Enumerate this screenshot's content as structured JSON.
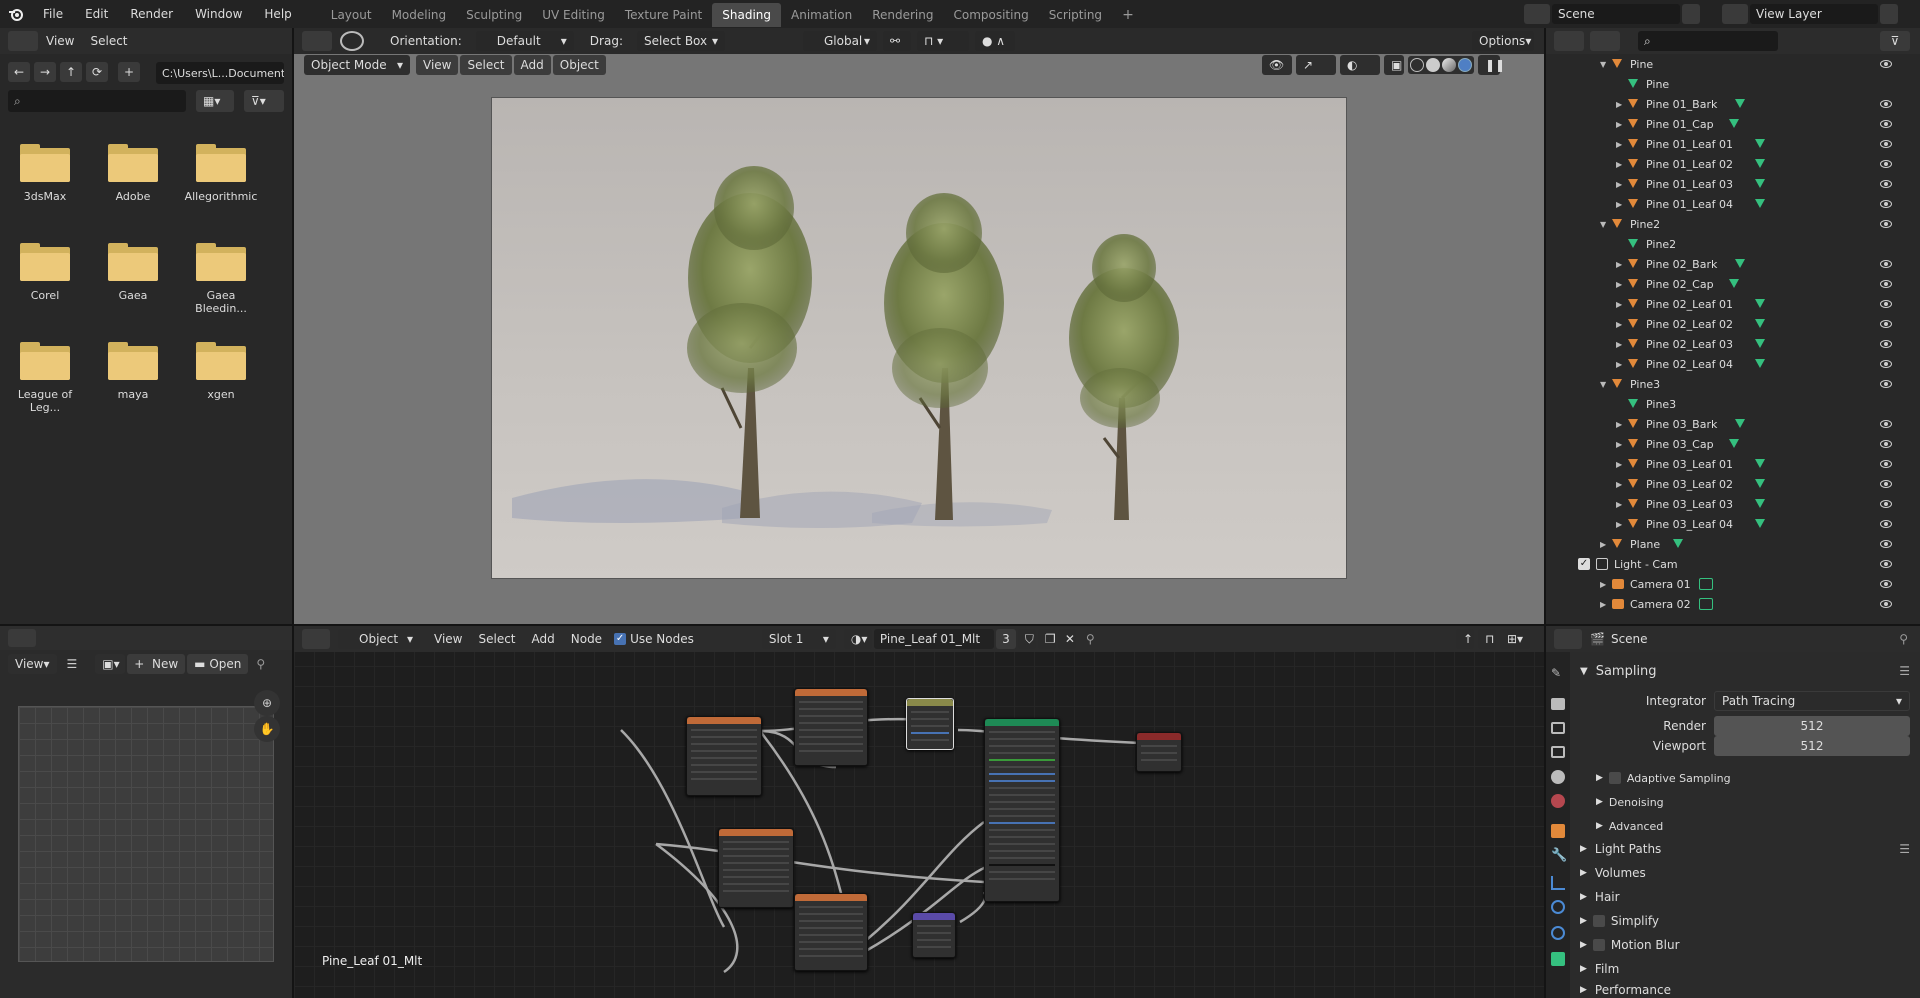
{
  "topbar": {
    "menus": [
      "File",
      "Edit",
      "Render",
      "Window",
      "Help"
    ],
    "workspaces": [
      "Layout",
      "Modeling",
      "Sculpting",
      "UV Editing",
      "Texture Paint",
      "Shading",
      "Animation",
      "Rendering",
      "Compositing",
      "Scripting"
    ],
    "active_workspace": "Shading",
    "add_tab": "+",
    "scene": "Scene",
    "view_layer": "View Layer"
  },
  "file_browser": {
    "menus": [
      "View",
      "Select"
    ],
    "path": "C:\\Users\\L...Documents\\",
    "search_placeholder": "",
    "folders": [
      "3dsMax",
      "Adobe",
      "Allegorithmic",
      "Corel",
      "Gaea",
      "Gaea Bleedin...",
      "League of Leg...",
      "maya",
      "xgen"
    ]
  },
  "viewport": {
    "orientation_label": "Orientation:",
    "orientation_value": "Default",
    "drag_label": "Drag:",
    "drag_value": "Select Box",
    "transform": "Global",
    "options": "Options",
    "mode": "Object Mode",
    "menus": [
      "View",
      "Select",
      "Add",
      "Object"
    ]
  },
  "outliner": {
    "rows": [
      {
        "label": "Pine",
        "type": "empty",
        "indent": 1,
        "expanded": true,
        "eye": true
      },
      {
        "label": "Pine",
        "type": "mesh",
        "indent": 2,
        "eye": false
      },
      {
        "label": "Pine 01_Bark",
        "type": "obj",
        "indent": 2,
        "eye": true
      },
      {
        "label": "Pine 01_Cap",
        "type": "obj",
        "indent": 2,
        "eye": true
      },
      {
        "label": "Pine 01_Leaf 01",
        "type": "obj",
        "indent": 2,
        "eye": true
      },
      {
        "label": "Pine 01_Leaf 02",
        "type": "obj",
        "indent": 2,
        "eye": true
      },
      {
        "label": "Pine 01_Leaf 03",
        "type": "obj",
        "indent": 2,
        "eye": true
      },
      {
        "label": "Pine 01_Leaf 04",
        "type": "obj",
        "indent": 2,
        "eye": true
      },
      {
        "label": "Pine2",
        "type": "empty",
        "indent": 1,
        "expanded": true,
        "eye": true
      },
      {
        "label": "Pine2",
        "type": "mesh",
        "indent": 2,
        "eye": false
      },
      {
        "label": "Pine 02_Bark",
        "type": "obj",
        "indent": 2,
        "eye": true
      },
      {
        "label": "Pine 02_Cap",
        "type": "obj",
        "indent": 2,
        "eye": true
      },
      {
        "label": "Pine 02_Leaf 01",
        "type": "obj",
        "indent": 2,
        "eye": true
      },
      {
        "label": "Pine 02_Leaf 02",
        "type": "obj",
        "indent": 2,
        "eye": true
      },
      {
        "label": "Pine 02_Leaf 03",
        "type": "obj",
        "indent": 2,
        "eye": true
      },
      {
        "label": "Pine 02_Leaf 04",
        "type": "obj",
        "indent": 2,
        "eye": true
      },
      {
        "label": "Pine3",
        "type": "empty",
        "indent": 1,
        "expanded": true,
        "eye": true
      },
      {
        "label": "Pine3",
        "type": "mesh",
        "indent": 2,
        "eye": false
      },
      {
        "label": "Pine 03_Bark",
        "type": "obj",
        "indent": 2,
        "eye": true
      },
      {
        "label": "Pine 03_Cap",
        "type": "obj",
        "indent": 2,
        "eye": true
      },
      {
        "label": "Pine 03_Leaf 01",
        "type": "obj",
        "indent": 2,
        "eye": true
      },
      {
        "label": "Pine 03_Leaf 02",
        "type": "obj",
        "indent": 2,
        "eye": true
      },
      {
        "label": "Pine 03_Leaf 03",
        "type": "obj",
        "indent": 2,
        "eye": true
      },
      {
        "label": "Pine 03_Leaf 04",
        "type": "obj",
        "indent": 2,
        "eye": true
      },
      {
        "label": "Plane",
        "type": "obj",
        "indent": 1,
        "eye": true
      },
      {
        "label": "Light - Cam",
        "type": "collection",
        "indent": 0,
        "eye": true
      },
      {
        "label": "Camera 01",
        "type": "camera",
        "indent": 1,
        "eye": true
      },
      {
        "label": "Camera 02",
        "type": "camera",
        "indent": 1,
        "eye": true
      }
    ]
  },
  "image_editor": {
    "view": "View",
    "new_button": "New",
    "open_button": "Open"
  },
  "node_editor": {
    "object_type": "Object",
    "menus": [
      "View",
      "Select",
      "Add",
      "Node"
    ],
    "use_nodes": "Use Nodes",
    "slot": "Slot 1",
    "material": "Pine_Leaf 01_Mlt",
    "users": "3",
    "material_label": "Pine_Leaf 01_Mlt"
  },
  "properties": {
    "scene": "Scene",
    "sampling": "Sampling",
    "integrator_label": "Integrator",
    "integrator_value": "Path Tracing",
    "render_label": "Render",
    "render_value": "512",
    "viewport_label": "Viewport",
    "viewport_value": "512",
    "sub_panels": [
      "Adaptive Sampling",
      "Denoising",
      "Advanced"
    ],
    "panels": [
      "Light Paths",
      "Volumes",
      "Hair",
      "Simplify",
      "Motion Blur",
      "Film",
      "Performance"
    ]
  }
}
